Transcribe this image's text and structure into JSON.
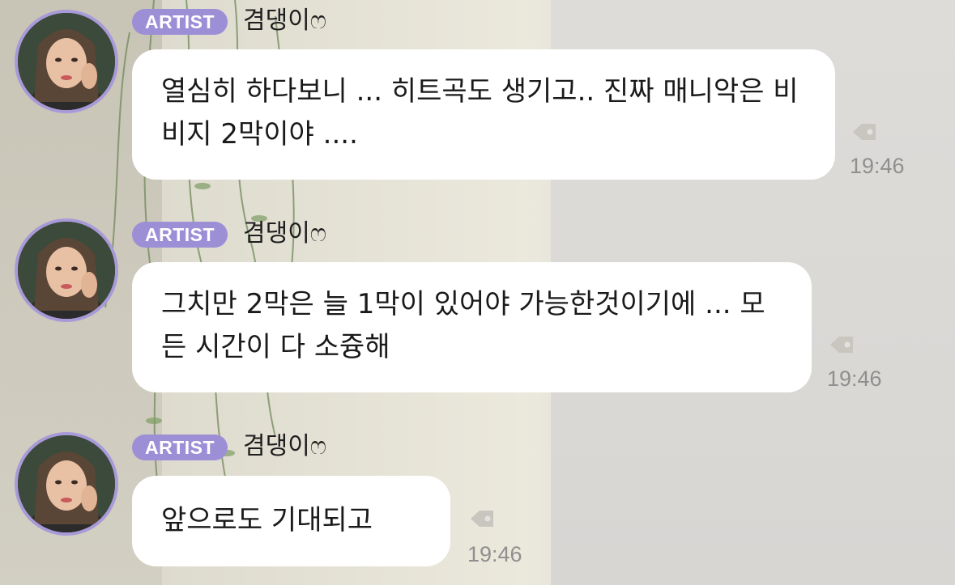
{
  "colors": {
    "badge_bg": "#9d8fd6",
    "avatar_ring": "#a89ad8",
    "bubble_bg": "#ffffff",
    "time_text": "#8f8f8f"
  },
  "messages": [
    {
      "badge": "ARTIST",
      "username": "겸댕이ෆ",
      "text": "열심히 하다보니 ... 히트곡도 생기고.. 진짜 매니악은 비비지 2막이야 ....",
      "time": "19:46",
      "icon": "tag-icon"
    },
    {
      "badge": "ARTIST",
      "username": "겸댕이ෆ",
      "text": "그치만 2막은 늘 1막이 있어야 가능한것이기에 ... 모든 시간이 다 소즁해",
      "time": "19:46",
      "icon": "tag-icon"
    },
    {
      "badge": "ARTIST",
      "username": "겸댕이ෆ",
      "text": "앞으로도 기대되고",
      "time": "19:46",
      "icon": "tag-icon"
    }
  ]
}
